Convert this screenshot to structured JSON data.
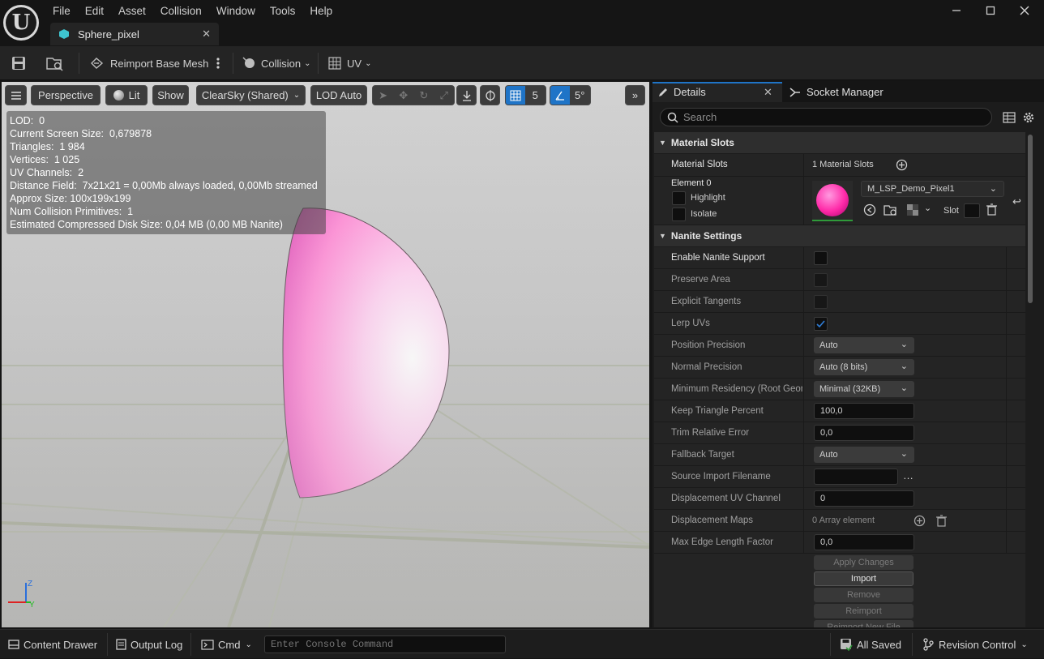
{
  "menu": [
    "File",
    "Edit",
    "Asset",
    "Collision",
    "Window",
    "Tools",
    "Help"
  ],
  "tab": {
    "title": "Sphere_pixel"
  },
  "toolbar": {
    "reimport_label": "Reimport Base Mesh",
    "collision_label": "Collision",
    "uv_label": "UV"
  },
  "viewport": {
    "perspective": "Perspective",
    "lit": "Lit",
    "show": "Show",
    "sky": "ClearSky (Shared)",
    "lod": "LOD Auto",
    "grid_value": "5",
    "angle_value": "5°",
    "stats": [
      "LOD:  0",
      "Current Screen Size:  0,679878",
      "Triangles:  1 984",
      "Vertices:  1 025",
      "UV Channels:  2",
      "Distance Field:  7x21x21 = 0,00Mb always loaded, 0,00Mb streamed",
      "Approx Size: 100x199x199",
      "Num Collision Primitives:  1",
      "Estimated Compressed Disk Size: 0,04 MB (0,00 MB Nanite)"
    ],
    "axis_z": "Z",
    "axis_y": "Y"
  },
  "details": {
    "tab_details": "Details",
    "tab_socket": "Socket Manager",
    "search_placeholder": "Search",
    "material_slots_cat": "Material Slots",
    "material_slots_label": "Material Slots",
    "material_slots_value": "1 Material Slots",
    "element_label": "Element 0",
    "highlight": "Highlight",
    "isolate": "Isolate",
    "material_name": "M_LSP_Demo_Pixel1",
    "slot_label": "Slot",
    "nanite_cat": "Nanite Settings",
    "rows": [
      {
        "label": "Enable Nanite Support",
        "enabled": true,
        "kind": "check",
        "checked": false
      },
      {
        "label": "Preserve Area",
        "enabled": false,
        "kind": "check",
        "checked": false
      },
      {
        "label": "Explicit Tangents",
        "enabled": false,
        "kind": "check",
        "checked": false
      },
      {
        "label": "Lerp UVs",
        "enabled": false,
        "kind": "check",
        "checked": true
      },
      {
        "label": "Position Precision",
        "enabled": false,
        "kind": "dropdown",
        "value": "Auto"
      },
      {
        "label": "Normal Precision",
        "enabled": false,
        "kind": "dropdown",
        "value": "Auto (8 bits)"
      },
      {
        "label": "Minimum Residency (Root Geon",
        "enabled": false,
        "kind": "dropdown",
        "value": "Minimal (32KB)"
      },
      {
        "label": "Keep Triangle Percent",
        "enabled": false,
        "kind": "number",
        "value": "100,0"
      },
      {
        "label": "Trim Relative Error",
        "enabled": false,
        "kind": "number",
        "value": "0,0"
      },
      {
        "label": "Fallback Target",
        "enabled": false,
        "kind": "dropdown",
        "value": "Auto"
      },
      {
        "label": "Source Import Filename",
        "enabled": false,
        "kind": "file",
        "value": ""
      },
      {
        "label": "Displacement UV Channel",
        "enabled": false,
        "kind": "number",
        "value": "0"
      },
      {
        "label": "Displacement Maps",
        "enabled": false,
        "kind": "array",
        "value": "0 Array element"
      },
      {
        "label": "Max Edge Length Factor",
        "enabled": false,
        "kind": "number",
        "value": "0,0"
      }
    ],
    "buttons": [
      {
        "label": "Apply Changes",
        "enabled": false
      },
      {
        "label": "Import",
        "enabled": true
      },
      {
        "label": "Remove",
        "enabled": false
      },
      {
        "label": "Reimport",
        "enabled": false
      },
      {
        "label": "Reimport New File",
        "enabled": false
      }
    ]
  },
  "statusbar": {
    "content_drawer": "Content Drawer",
    "output_log": "Output Log",
    "cmd": "Cmd",
    "console_placeholder": "Enter Console Command",
    "all_saved": "All Saved",
    "revision_control": "Revision Control"
  },
  "colors": {
    "accent": "#1f74c7",
    "material": "#ff3fb4",
    "selected_tab": "#3ec4cf"
  }
}
